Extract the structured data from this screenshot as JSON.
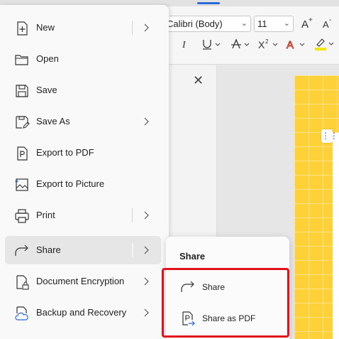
{
  "ribbon": {
    "font_name": "Calibri (Body)",
    "font_size": "11"
  },
  "menu": {
    "items": [
      {
        "label": "New",
        "icon": "new-document-icon",
        "has_submenu": true,
        "split": true
      },
      {
        "label": "Open",
        "icon": "folder-icon",
        "has_submenu": false
      },
      {
        "label": "Save",
        "icon": "save-icon",
        "has_submenu": false
      },
      {
        "label": "Save As",
        "icon": "save-as-icon",
        "has_submenu": true
      },
      {
        "label": "Export to PDF",
        "icon": "export-pdf-icon",
        "has_submenu": false
      },
      {
        "label": "Export to Picture",
        "icon": "export-picture-icon",
        "has_submenu": false
      },
      {
        "label": "Print",
        "icon": "printer-icon",
        "has_submenu": true,
        "split": true
      },
      {
        "label": "Share",
        "icon": "share-icon",
        "has_submenu": true,
        "split": true,
        "active": true
      },
      {
        "label": "Document Encryption",
        "icon": "document-lock-icon",
        "has_submenu": true
      },
      {
        "label": "Backup and Recovery",
        "icon": "cloud-backup-icon",
        "has_submenu": true
      }
    ]
  },
  "submenu": {
    "title": "Share",
    "items": [
      {
        "label": "Share",
        "icon": "share-icon"
      },
      {
        "label": "Share as PDF",
        "icon": "share-pdf-icon"
      }
    ]
  },
  "colors": {
    "highlight_border": "#e3121a",
    "accent": "#2b6ad9",
    "page_fill": "#fdd137"
  }
}
